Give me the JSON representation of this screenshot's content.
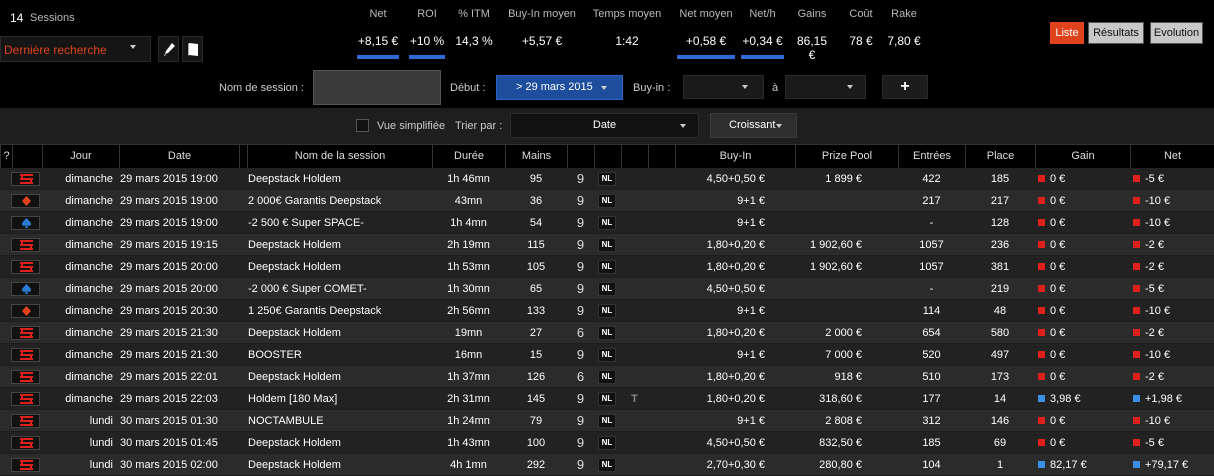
{
  "header": {
    "sessions_count": "14",
    "sessions_label": "Sessions",
    "search_select": "Dernière recherche"
  },
  "stats": [
    {
      "label": "Net",
      "value": "+8,15 €",
      "highlight": true
    },
    {
      "label": "ROI",
      "value": "+10 %",
      "highlight": true
    },
    {
      "label": "% ITM",
      "value": "14,3 %",
      "highlight": false
    },
    {
      "label": "Buy-In moyen",
      "value": "+5,57 €",
      "highlight": false
    },
    {
      "label": "Temps moyen",
      "value": "1:42",
      "highlight": false
    },
    {
      "label": "Net moyen",
      "value": "+0,58 €",
      "highlight": true
    },
    {
      "label": "Net/h",
      "value": "+0,34 €",
      "highlight": true
    },
    {
      "label": "Gains",
      "value": "86,15 €",
      "highlight": false
    },
    {
      "label": "Coût",
      "value": "78 €",
      "highlight": false
    },
    {
      "label": "Rake",
      "value": "7,80 €",
      "highlight": false
    }
  ],
  "view_tabs": [
    {
      "label": "Liste",
      "active": true
    },
    {
      "label": "Résultats",
      "active": false
    },
    {
      "label": "Evolution",
      "active": false
    }
  ],
  "filters": {
    "session_name_label": "Nom de session :",
    "session_name_value": "",
    "start_label": "Début :",
    "start_value": "> 29 mars 2015",
    "buyin_label": "Buy-in :",
    "buyin_from": "",
    "to_label": "à",
    "buyin_to": "",
    "add_label": "+"
  },
  "sortbar": {
    "simplified_label": "Vue simplifiée",
    "simplified_checked": false,
    "sort_by_label": "Trier par :",
    "sort_field": "Date",
    "sort_order": "Croissant"
  },
  "table": {
    "columns": [
      "?",
      "",
      "Jour",
      "Date",
      "",
      "Nom de la session",
      "Durée",
      "Mains",
      "",
      "",
      "",
      "",
      "Buy-In",
      "Prize Pool",
      "Entrées",
      "Place",
      "Gain",
      "Net"
    ],
    "rows": [
      {
        "site": "winamax",
        "jour": "dimanche",
        "date": "29 mars 2015 19:00",
        "name": "Deepstack Holdem",
        "duree": "1h 46mn",
        "mains": "95",
        "table": "9",
        "type": "NL",
        "turbo": "",
        "buyin": "4,50+0,50 €",
        "prize": "1 899 €",
        "entrees": "422",
        "place": "185",
        "gain": "0 €",
        "gain_color": "#e0201c",
        "net": "-5 €",
        "net_color": "#e0201c"
      },
      {
        "site": "diamond",
        "jour": "dimanche",
        "date": "29 mars 2015 19:00",
        "name": "2 000€ Garantis Deepstack",
        "duree": "43mn",
        "mains": "36",
        "table": "9",
        "type": "NL",
        "turbo": "",
        "buyin": "9+1 €",
        "prize": "",
        "entrees": "217",
        "place": "217",
        "gain": "0 €",
        "gain_color": "#e0201c",
        "net": "-10 €",
        "net_color": "#e0201c"
      },
      {
        "site": "spade",
        "jour": "dimanche",
        "date": "29 mars 2015 19:00",
        "name": "-2 500 € Super SPACE-",
        "duree": "1h 4mn",
        "mains": "54",
        "table": "9",
        "type": "NL",
        "turbo": "",
        "buyin": "9+1 €",
        "prize": "",
        "entrees": "-",
        "place": "128",
        "gain": "0 €",
        "gain_color": "#e0201c",
        "net": "-10 €",
        "net_color": "#e0201c"
      },
      {
        "site": "winamax",
        "jour": "dimanche",
        "date": "29 mars 2015 19:15",
        "name": "Deepstack Holdem",
        "duree": "2h 19mn",
        "mains": "115",
        "table": "9",
        "type": "NL",
        "turbo": "",
        "buyin": "1,80+0,20 €",
        "prize": "1 902,60 €",
        "entrees": "1057",
        "place": "236",
        "gain": "0 €",
        "gain_color": "#e0201c",
        "net": "-2 €",
        "net_color": "#e0201c"
      },
      {
        "site": "winamax",
        "jour": "dimanche",
        "date": "29 mars 2015 20:00",
        "name": "Deepstack Holdem",
        "duree": "1h 53mn",
        "mains": "105",
        "table": "9",
        "type": "NL",
        "turbo": "",
        "buyin": "1,80+0,20 €",
        "prize": "1 902,60 €",
        "entrees": "1057",
        "place": "381",
        "gain": "0 €",
        "gain_color": "#e0201c",
        "net": "-2 €",
        "net_color": "#e0201c"
      },
      {
        "site": "spade",
        "jour": "dimanche",
        "date": "29 mars 2015 20:00",
        "name": "-2 000 € Super COMET-",
        "duree": "1h 30mn",
        "mains": "65",
        "table": "9",
        "type": "NL",
        "turbo": "",
        "buyin": "4,50+0,50 €",
        "prize": "",
        "entrees": "-",
        "place": "219",
        "gain": "0 €",
        "gain_color": "#e0201c",
        "net": "-5 €",
        "net_color": "#e0201c"
      },
      {
        "site": "diamond",
        "jour": "dimanche",
        "date": "29 mars 2015 20:30",
        "name": "1 250€ Garantis Deepstack",
        "duree": "2h 56mn",
        "mains": "133",
        "table": "9",
        "type": "NL",
        "turbo": "",
        "buyin": "9+1 €",
        "prize": "",
        "entrees": "114",
        "place": "48",
        "gain": "0 €",
        "gain_color": "#e0201c",
        "net": "-10 €",
        "net_color": "#e0201c"
      },
      {
        "site": "winamax",
        "jour": "dimanche",
        "date": "29 mars 2015 21:30",
        "name": "Deepstack Holdem",
        "duree": "19mn",
        "mains": "27",
        "table": "6",
        "type": "NL",
        "turbo": "",
        "buyin": "1,80+0,20 €",
        "prize": "2 000 €",
        "entrees": "654",
        "place": "580",
        "gain": "0 €",
        "gain_color": "#e0201c",
        "net": "-2 €",
        "net_color": "#e0201c"
      },
      {
        "site": "winamax",
        "jour": "dimanche",
        "date": "29 mars 2015 21:30",
        "name": "BOOSTER",
        "duree": "16mn",
        "mains": "15",
        "table": "9",
        "type": "NL",
        "turbo": "",
        "buyin": "9+1 €",
        "prize": "7 000 €",
        "entrees": "520",
        "place": "497",
        "gain": "0 €",
        "gain_color": "#e0201c",
        "net": "-10 €",
        "net_color": "#e0201c"
      },
      {
        "site": "winamax",
        "jour": "dimanche",
        "date": "29 mars 2015 22:01",
        "name": "Deepstack Holdem",
        "duree": "1h 37mn",
        "mains": "126",
        "table": "6",
        "type": "NL",
        "turbo": "",
        "buyin": "1,80+0,20 €",
        "prize": "918 €",
        "entrees": "510",
        "place": "173",
        "gain": "0 €",
        "gain_color": "#e0201c",
        "net": "-2 €",
        "net_color": "#e0201c"
      },
      {
        "site": "winamax",
        "jour": "dimanche",
        "date": "29 mars 2015 22:03",
        "name": "Holdem [180 Max]",
        "duree": "2h 31mn",
        "mains": "145",
        "table": "9",
        "type": "NL",
        "turbo": "T",
        "buyin": "1,80+0,20 €",
        "prize": "318,60 €",
        "entrees": "177",
        "place": "14",
        "gain": "3,98 €",
        "gain_color": "#3a8ee6",
        "net": "+1,98 €",
        "net_color": "#3a8ee6"
      },
      {
        "site": "winamax",
        "jour": "lundi",
        "date": "30 mars 2015 01:30",
        "name": "NOCTAMBULE",
        "duree": "1h 24mn",
        "mains": "79",
        "table": "9",
        "type": "NL",
        "turbo": "",
        "buyin": "9+1 €",
        "prize": "2 808 €",
        "entrees": "312",
        "place": "146",
        "gain": "0 €",
        "gain_color": "#e0201c",
        "net": "-10 €",
        "net_color": "#e0201c"
      },
      {
        "site": "winamax",
        "jour": "lundi",
        "date": "30 mars 2015 01:45",
        "name": "Deepstack Holdem",
        "duree": "1h 43mn",
        "mains": "100",
        "table": "9",
        "type": "NL",
        "turbo": "",
        "buyin": "4,50+0,50 €",
        "prize": "832,50 €",
        "entrees": "185",
        "place": "69",
        "gain": "0 €",
        "gain_color": "#e0201c",
        "net": "-5 €",
        "net_color": "#e0201c"
      },
      {
        "site": "winamax",
        "jour": "lundi",
        "date": "30 mars 2015 02:00",
        "name": "Deepstack Holdem",
        "duree": "4h 1mn",
        "mains": "292",
        "table": "9",
        "type": "NL",
        "turbo": "",
        "buyin": "2,70+0,30 €",
        "prize": "280,80 €",
        "entrees": "104",
        "place": "1",
        "gain": "82,17 €",
        "gain_color": "#3a8ee6",
        "net": "+79,17 €",
        "net_color": "#3a8ee6"
      }
    ]
  },
  "colors": {
    "accent": "#e0431c",
    "stat_bar": "#2a6cd4",
    "date_button": "#1d4d9c",
    "loss": "#e0201c",
    "win": "#3a8ee6"
  }
}
